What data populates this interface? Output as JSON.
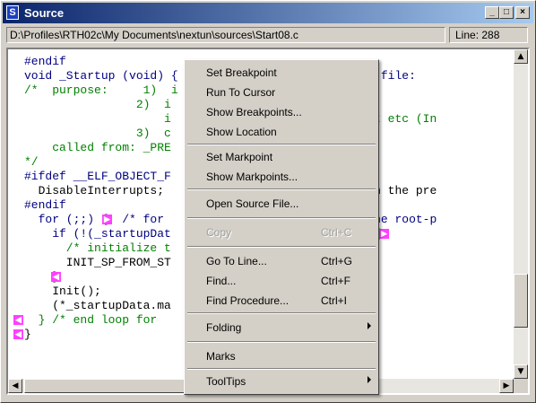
{
  "window": {
    "title": "Source",
    "title_icon": "S"
  },
  "controls": {
    "minimize": "_",
    "maximize": "□",
    "close": "×"
  },
  "path": "D:\\Profiles\\RTH02c\\My Documents\\nextun\\sources\\Start08.c",
  "line_indicator": "Line: 288",
  "code_lines": [
    {
      "text": "#endif"
    },
    {
      "text": "void _Startup (void) {                er parameter file:"
    },
    {
      "text": "/*  purpose:     1)  i"
    },
    {
      "text": "                2)  i"
    },
    {
      "text": "                    i                  own init dat etc (In"
    },
    {
      "text": "                3)  c"
    },
    {
      "text": "    called from: _PRE                  he Linker"
    },
    {
      "text": "*/"
    },
    {
      "text": "#ifdef __ELF_OBJECT_F"
    },
    {
      "text": "  DisableInterrupts;                   s is done in the pre"
    },
    {
      "text": "#endif"
    },
    {
      "text": "  for (;;) {  /* for                   ram; call the root-p"
    },
    {
      "text": "    if (!(_startupDat                  _INIT_SP)) { "
    },
    {
      "text": "      /* initialize t"
    },
    {
      "text": "      INIT_SP_FROM_ST"
    },
    {
      "text": "    }"
    },
    {
      "text": "    Init();"
    },
    {
      "text": "    (*_startupData.ma"
    },
    {
      "text": "  } /* end loop for"
    },
    {
      "text": "}"
    }
  ],
  "context_menu": {
    "items": [
      {
        "label": "Set Breakpoint",
        "shortcut": ""
      },
      {
        "label": "Run To Cursor",
        "shortcut": ""
      },
      {
        "label": "Show Breakpoints...",
        "shortcut": ""
      },
      {
        "label": "Show Location",
        "shortcut": ""
      },
      {
        "label": "Set Markpoint",
        "shortcut": ""
      },
      {
        "label": "Show Markpoints...",
        "shortcut": ""
      },
      {
        "label": "Open Source File...",
        "shortcut": ""
      },
      {
        "label": "Copy",
        "shortcut": "Ctrl+C",
        "disabled": true
      },
      {
        "label": "Go To Line...",
        "shortcut": "Ctrl+G"
      },
      {
        "label": "Find...",
        "shortcut": "Ctrl+F"
      },
      {
        "label": "Find Procedure...",
        "shortcut": "Ctrl+I"
      },
      {
        "label": "Folding",
        "shortcut": "",
        "submenu": true
      },
      {
        "label": "Marks",
        "shortcut": ""
      },
      {
        "label": "ToolTips",
        "shortcut": "",
        "submenu": true
      }
    ]
  },
  "colors": {
    "title_start": "#0a246a",
    "title_end": "#a6caf0",
    "keyword": "#000080",
    "comment": "#008000",
    "fold_marker": "#ff40ff"
  }
}
